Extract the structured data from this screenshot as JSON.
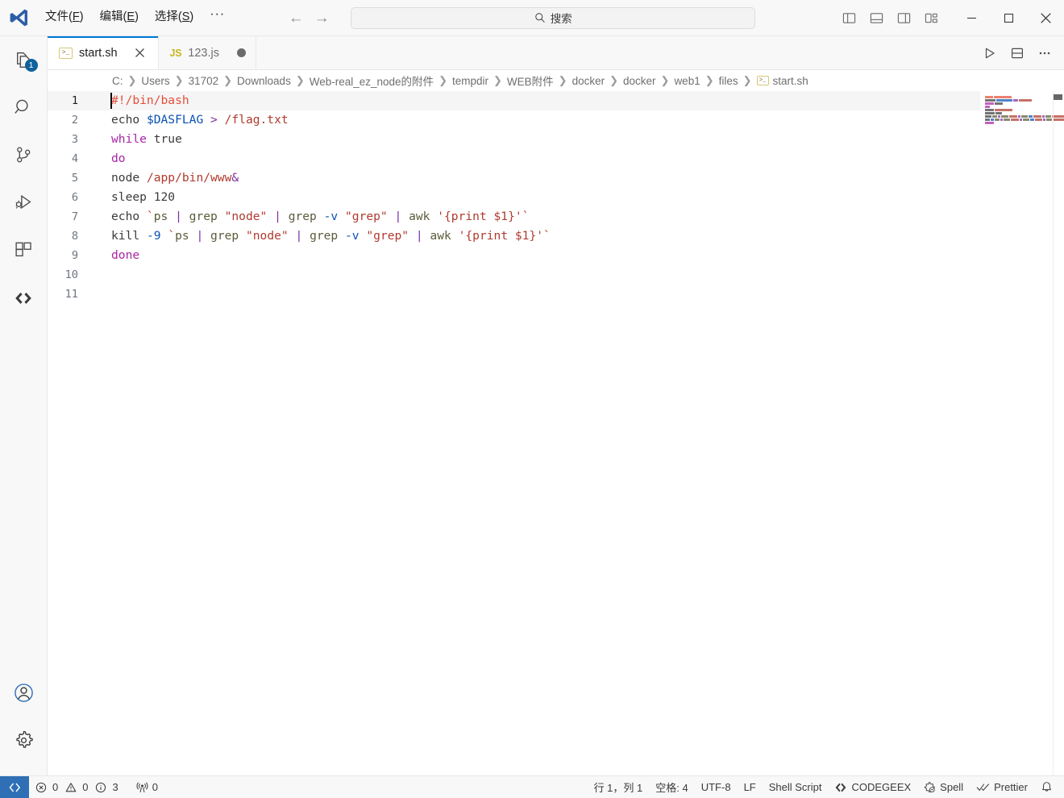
{
  "titlebar": {
    "logo_icon": "vscode-logo-icon",
    "menus": [
      {
        "label_prefix": "文件",
        "mnemonic": "F",
        "name": "menu-file"
      },
      {
        "label_prefix": "编辑",
        "mnemonic": "E",
        "name": "menu-edit"
      },
      {
        "label_prefix": "选择",
        "mnemonic": "S",
        "name": "menu-select"
      }
    ],
    "menu_more": "···",
    "nav_back": "←",
    "nav_forward": "→",
    "search_placeholder": "搜索",
    "search_icon": "search-icon",
    "layout_buttons": [
      {
        "name": "toggle-primary-sidebar-icon"
      },
      {
        "name": "toggle-panel-icon"
      },
      {
        "name": "toggle-secondary-sidebar-icon"
      },
      {
        "name": "customize-layout-icon"
      }
    ],
    "window_buttons": [
      {
        "name": "minimize-button",
        "glyph": "minimize-icon"
      },
      {
        "name": "maximize-button",
        "glyph": "maximize-icon"
      },
      {
        "name": "close-button",
        "glyph": "close-icon"
      }
    ]
  },
  "activitybar": {
    "items": [
      {
        "name": "activity-explorer",
        "icon": "files-icon",
        "badge": "1"
      },
      {
        "name": "activity-search",
        "icon": "search-icon",
        "badge": ""
      },
      {
        "name": "activity-source-control",
        "icon": "source-control-icon",
        "badge": ""
      },
      {
        "name": "activity-run-debug",
        "icon": "run-and-debug-icon",
        "badge": ""
      },
      {
        "name": "activity-extensions",
        "icon": "extensions-icon",
        "badge": ""
      },
      {
        "name": "activity-codegeex",
        "icon": "code-chevrons-icon",
        "badge": ""
      }
    ],
    "bottom_items": [
      {
        "name": "activity-accounts",
        "icon": "account-icon"
      },
      {
        "name": "activity-settings",
        "icon": "gear-icon"
      }
    ]
  },
  "tabs": [
    {
      "label": "start.sh",
      "icon": "shell-file-icon",
      "active": true,
      "dirty": false,
      "close_glyph": "✕"
    },
    {
      "label": "123.js",
      "icon": "js-file-icon",
      "active": false,
      "dirty": true,
      "close_glyph": "✕"
    }
  ],
  "editor_actions": [
    {
      "name": "run-code-button",
      "icon": "play-icon"
    },
    {
      "name": "split-editor-down-button",
      "icon": "split-editor-icon"
    },
    {
      "name": "more-actions-button",
      "icon": "ellipsis-icon"
    }
  ],
  "breadcrumb": {
    "items": [
      "C:",
      "Users",
      "31702",
      "Downloads",
      "Web-real_ez_node的附件",
      "tempdir",
      "WEB附件",
      "docker",
      "docker",
      "web1",
      "files"
    ],
    "file": "start.sh",
    "file_icon": "shell-file-icon",
    "separator": "❯"
  },
  "editor": {
    "language": "Shell Script",
    "lines": [
      {
        "num": "1",
        "tokens": [
          {
            "t": "#!/bin/bash",
            "c": "t-shebang"
          }
        ]
      },
      {
        "num": "2",
        "tokens": [
          {
            "t": "echo ",
            "c": "t-plain"
          },
          {
            "t": "$DASFLAG",
            "c": "t-var"
          },
          {
            "t": " > ",
            "c": "t-op"
          },
          {
            "t": "/flag.txt",
            "c": "t-path"
          }
        ]
      },
      {
        "num": "3",
        "tokens": [
          {
            "t": "while",
            "c": "t-kw"
          },
          {
            "t": " true",
            "c": "t-plain"
          }
        ]
      },
      {
        "num": "4",
        "tokens": [
          {
            "t": "do",
            "c": "t-kw"
          }
        ]
      },
      {
        "num": "5",
        "tokens": [
          {
            "t": "node ",
            "c": "t-plain"
          },
          {
            "t": "/app/bin/www",
            "c": "t-path"
          },
          {
            "t": "&",
            "c": "t-op"
          }
        ]
      },
      {
        "num": "6",
        "tokens": [
          {
            "t": "sleep ",
            "c": "t-plain"
          },
          {
            "t": "120",
            "c": "t-num"
          }
        ]
      },
      {
        "num": "7",
        "tokens": [
          {
            "t": "echo ",
            "c": "t-plain"
          },
          {
            "t": "`",
            "c": "t-tick"
          },
          {
            "t": "ps ",
            "c": "t-cmd"
          },
          {
            "t": "| ",
            "c": "t-pipe"
          },
          {
            "t": "grep ",
            "c": "t-cmd"
          },
          {
            "t": "\"node\"",
            "c": "t-str"
          },
          {
            "t": " | ",
            "c": "t-pipe"
          },
          {
            "t": "grep ",
            "c": "t-cmd"
          },
          {
            "t": "-v",
            "c": "t-flag"
          },
          {
            "t": " ",
            "c": "t-plain"
          },
          {
            "t": "\"grep\"",
            "c": "t-str"
          },
          {
            "t": " | ",
            "c": "t-pipe"
          },
          {
            "t": "awk ",
            "c": "t-cmd"
          },
          {
            "t": "'{print $1}'",
            "c": "t-str"
          },
          {
            "t": "`",
            "c": "t-tick"
          }
        ]
      },
      {
        "num": "8",
        "tokens": [
          {
            "t": "kill ",
            "c": "t-plain"
          },
          {
            "t": "-9",
            "c": "t-flag"
          },
          {
            "t": " ",
            "c": "t-plain"
          },
          {
            "t": "`",
            "c": "t-tick"
          },
          {
            "t": "ps ",
            "c": "t-cmd"
          },
          {
            "t": "| ",
            "c": "t-pipe"
          },
          {
            "t": "grep ",
            "c": "t-cmd"
          },
          {
            "t": "\"node\"",
            "c": "t-str"
          },
          {
            "t": " | ",
            "c": "t-pipe"
          },
          {
            "t": "grep ",
            "c": "t-cmd"
          },
          {
            "t": "-v",
            "c": "t-flag"
          },
          {
            "t": " ",
            "c": "t-plain"
          },
          {
            "t": "\"grep\"",
            "c": "t-str"
          },
          {
            "t": " | ",
            "c": "t-pipe"
          },
          {
            "t": "awk ",
            "c": "t-cmd"
          },
          {
            "t": "'{print $1}'",
            "c": "t-str"
          },
          {
            "t": "`",
            "c": "t-tick"
          }
        ]
      },
      {
        "num": "9",
        "tokens": [
          {
            "t": "done",
            "c": "t-kw"
          }
        ]
      },
      {
        "num": "10",
        "tokens": []
      },
      {
        "num": "11",
        "tokens": []
      }
    ],
    "active_line": 1,
    "cursor_line": 1,
    "cursor_column": 1
  },
  "statusbar": {
    "remote_icon": "remote-window-icon",
    "left": [
      {
        "name": "problems-errors",
        "icon": "error-circle-icon",
        "value": "0"
      },
      {
        "name": "problems-warnings",
        "icon": "warning-triangle-icon",
        "value": "0"
      },
      {
        "name": "problems-infos",
        "icon": "info-circle-icon",
        "value": "3"
      },
      {
        "name": "ports-forwarded",
        "icon": "radio-tower-icon",
        "value": "0"
      }
    ],
    "right": [
      {
        "name": "editor-cursor-position",
        "label": "行 1，列 1"
      },
      {
        "name": "editor-indentation",
        "label": "空格: 4"
      },
      {
        "name": "editor-encoding",
        "label": "UTF-8"
      },
      {
        "name": "editor-eol",
        "label": "LF"
      },
      {
        "name": "editor-language-mode",
        "label": "Shell Script"
      },
      {
        "name": "status-codegeex",
        "label": "CODEGEEX",
        "icon": "code-chevrons-icon"
      },
      {
        "name": "status-spell",
        "label": "Spell",
        "icon": "spell-gear-icon"
      },
      {
        "name": "status-prettier",
        "label": "Prettier",
        "icon": "double-check-icon"
      },
      {
        "name": "status-notifications",
        "label": "",
        "icon": "bell-icon"
      }
    ]
  },
  "colors": {
    "accent": "#0078d4",
    "badge": "#0e639c",
    "remote": "#2f6fb5",
    "titlebar_bg": "#f8f8f8",
    "editor_bg": "#ffffff"
  },
  "minimap_rows": [
    [
      [
        10,
        "#e34f3a"
      ],
      [
        22,
        "#e34f3a"
      ]
    ],
    [
      [
        13,
        "#3b3b3b"
      ],
      [
        20,
        "#0a52b3"
      ],
      [
        6,
        "#7b2fa0"
      ],
      [
        16,
        "#b03a2e"
      ]
    ],
    [
      [
        11,
        "#a626a4"
      ],
      [
        10,
        "#3b3b3b"
      ]
    ],
    [
      [
        6,
        "#a626a4"
      ]
    ],
    [
      [
        11,
        "#3b3b3b"
      ],
      [
        22,
        "#b03a2e"
      ]
    ],
    [
      [
        12,
        "#3b3b3b"
      ],
      [
        8,
        "#3b3b3b"
      ]
    ],
    [
      [
        10,
        "#3b3b3b"
      ],
      [
        7,
        "#5b5b3b"
      ],
      [
        4,
        "#7b2fa0"
      ],
      [
        10,
        "#5b5b3b"
      ],
      [
        12,
        "#b03a2e"
      ],
      [
        4,
        "#7b2fa0"
      ],
      [
        10,
        "#5b5b3b"
      ],
      [
        6,
        "#0a52b3"
      ],
      [
        12,
        "#b03a2e"
      ],
      [
        4,
        "#7b2fa0"
      ],
      [
        8,
        "#5b5b3b"
      ],
      [
        18,
        "#b03a2e"
      ]
    ],
    [
      [
        8,
        "#3b3b3b"
      ],
      [
        5,
        "#0a52b3"
      ],
      [
        7,
        "#5b5b3b"
      ],
      [
        4,
        "#7b2fa0"
      ],
      [
        10,
        "#5b5b3b"
      ],
      [
        12,
        "#b03a2e"
      ],
      [
        4,
        "#7b2fa0"
      ],
      [
        10,
        "#5b5b3b"
      ],
      [
        6,
        "#0a52b3"
      ],
      [
        12,
        "#b03a2e"
      ],
      [
        4,
        "#7b2fa0"
      ],
      [
        8,
        "#5b5b3b"
      ],
      [
        18,
        "#b03a2e"
      ]
    ],
    [
      [
        11,
        "#a626a4"
      ]
    ]
  ]
}
